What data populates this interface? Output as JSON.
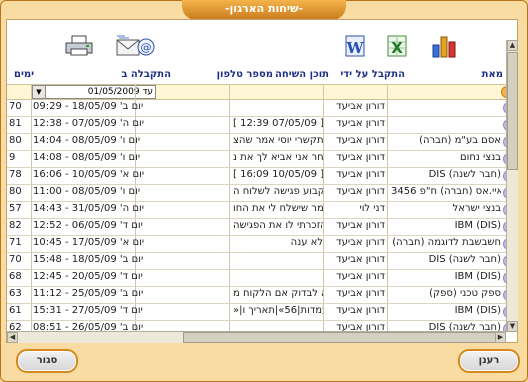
{
  "window": {
    "title": "-שיחות הארגון-"
  },
  "toolbar": {
    "icons": [
      "bar-chart-icon",
      "excel-icon",
      "word-icon",
      "email-icon",
      "printer-icon"
    ]
  },
  "columns": {
    "from": "מאת",
    "received_by": "התקבל על ידי",
    "content": "תוכן השיחה",
    "phone": "מספר טלפון",
    "received_at": "התקבלה ב",
    "days": "ימים"
  },
  "filter": {
    "date_value": "עד 01/05/2009"
  },
  "rows": [
    {
      "from": "",
      "received_by": "דורון אביעד",
      "content": "",
      "phone": "",
      "received_at": "יום ב' 18/05/09 - 09:29",
      "days": "70"
    },
    {
      "from": "",
      "received_by": "דורון אביעד",
      "content": "[ 12:39 07/05/09 ]:=",
      "phone": "",
      "received_at": "יום ה' 07/05/09 - 12:38",
      "days": "81"
    },
    {
      "from": "אסם בע\"מ (חברה)",
      "received_by": "דורון אביעד",
      "content": "התקשרי יוסי אמר שהצ",
      "phone": "",
      "received_at": "יום ו' 08/05/09 - 14:04",
      "days": "80"
    },
    {
      "from": "בנצי נחום",
      "received_by": "דורון אביעד",
      "content": "מחר אני אביא לך את נ",
      "phone": "",
      "received_at": "יום ו' 08/05/09 - 14:08",
      "days": "9"
    },
    {
      "from": "DIS (חבר לשנה)",
      "received_by": "דורון אביעד",
      "content": "[ 16:09 10/05/09 ]:=",
      "phone": "",
      "received_at": "יום א' 10/05/09 - 16:06",
      "days": "78"
    },
    {
      "from": "די.איי.אס (חברה) ח\"פ 3456",
      "received_by": "דורון אביעד",
      "content": "לקבוע פגישה לשלוח ה",
      "phone": "",
      "received_at": "יום ו' 08/05/09 - 11:00",
      "days": "80"
    },
    {
      "from": "בנצי ישראל",
      "received_by": "דני לוי",
      "content": "אמר שישלח לי את החו",
      "phone": "",
      "received_at": "יום ה' 31/05/09 - 14:43",
      "days": "57"
    },
    {
      "from": "IBM (DIS)",
      "received_by": "דורון אביעד",
      "content": "הזכרתי לו את הפגישה",
      "phone": "",
      "received_at": "יום ד' 06/05/09 - 12:52",
      "days": "82"
    },
    {
      "from": "חשבשבת לדוגמה (חברה)",
      "received_by": "דורון אביעד",
      "content": "לא ענה",
      "phone": "",
      "received_at": "יום א' 17/05/09 - 10:45",
      "days": "71"
    },
    {
      "from": "DIS (חבר לשנה)",
      "received_by": "דורון אביעד",
      "content": "",
      "phone": "",
      "received_at": "יום ב' 18/05/09 - 15:48",
      "days": "70"
    },
    {
      "from": "IBM (DIS)",
      "received_by": "דורון אביעד",
      "content": "",
      "phone": "",
      "received_at": "יום ד' 20/05/09 - 12:45",
      "days": "68"
    },
    {
      "from": "ספק טכני (ספק)",
      "received_by": "דורון אביעד",
      "content": "נא לבדוק אם הלקוח מ",
      "phone": "",
      "received_at": "יום ב' 25/05/09 - 11:12",
      "days": "63"
    },
    {
      "from": "IBM (DIS)",
      "received_by": "דורון אביעד",
      "content": "»|עמדות|56»|תאריך ו",
      "phone": "",
      "received_at": "יום ד' 27/05/09 - 15:31",
      "days": "61"
    },
    {
      "from": "DIS (חבר לשנה)",
      "received_by": "דורון אביעד",
      "content": "",
      "phone": "",
      "received_at": "יום ב' 26/05/09 - 08:51",
      "days": "62"
    }
  ],
  "buttons": {
    "close": "סגור",
    "refresh": "רענן"
  }
}
